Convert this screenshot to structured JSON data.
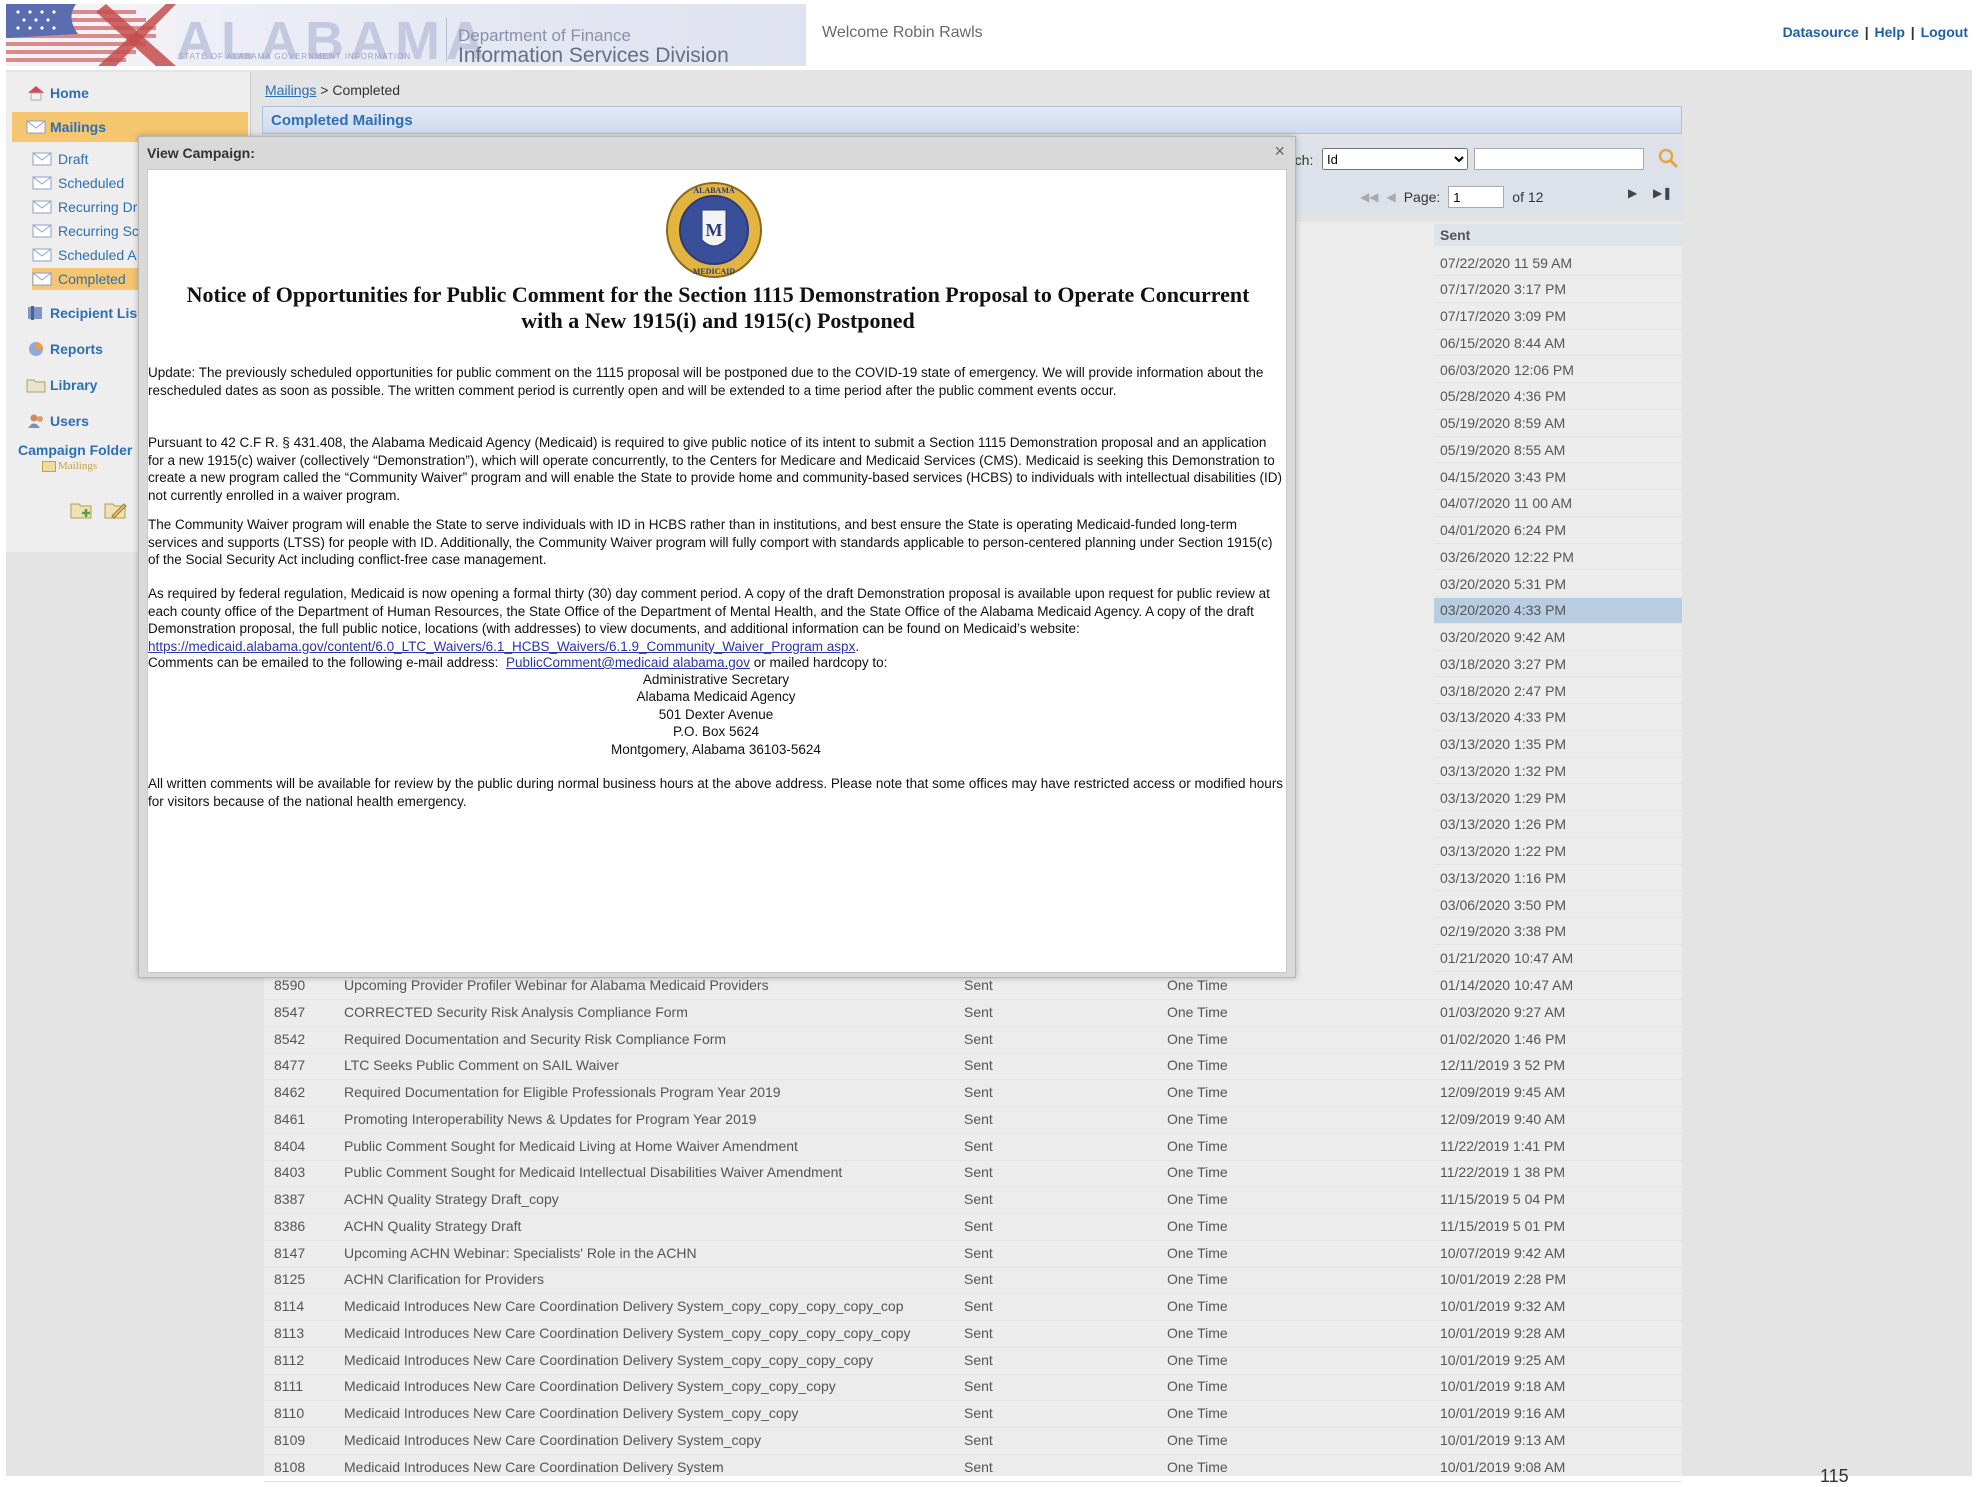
{
  "header": {
    "state_name": "ALABAMA",
    "state_sub": "STATE OF ALABAMA GOVERNMENT INFORMATION",
    "dept_line1": "Department of Finance",
    "dept_line2": "Information Services Division",
    "welcome": "Welcome Robin Rawls",
    "links": [
      "Datasource",
      "Help",
      "Logout"
    ]
  },
  "sidebar": {
    "main_items": [
      {
        "label": "Home",
        "icon": "home-icon"
      },
      {
        "label": "Mailings",
        "icon": "envelope-icon",
        "active": true
      },
      {
        "label": "Recipient Lis",
        "icon": "list-icon"
      },
      {
        "label": "Reports",
        "icon": "pie-chart-icon"
      },
      {
        "label": "Library",
        "icon": "folder-icon"
      },
      {
        "label": "Users",
        "icon": "users-icon"
      }
    ],
    "sub_items": [
      {
        "label": "Draft"
      },
      {
        "label": "Scheduled"
      },
      {
        "label": "Recurring Dr"
      },
      {
        "label": "Recurring Sc"
      },
      {
        "label": "Scheduled A"
      },
      {
        "label": "Completed",
        "active": true
      }
    ],
    "campaign_folder_label": "Campaign Folder",
    "folder_name": "Mailings"
  },
  "breadcrumb": {
    "parent": "Mailings",
    "separator": ">",
    "current": "Completed"
  },
  "panel": {
    "title": "Completed Mailings",
    "search_label": "rch:",
    "search_field_value": "Id",
    "search_value": "",
    "page_label": "Page:",
    "page_value": "1",
    "page_of": "of 12"
  },
  "table": {
    "sent_header": "Sent",
    "hidden_sent": [
      "07/22/2020 11 59 AM",
      "07/17/2020 3:17 PM",
      "07/17/2020 3:09 PM",
      "06/15/2020 8:44 AM",
      "06/03/2020 12:06 PM",
      "05/28/2020 4:36 PM",
      "05/19/2020 8:59 AM",
      "05/19/2020 8:55 AM",
      "04/15/2020 3:43 PM",
      "04/07/2020 11 00 AM",
      "04/01/2020 6:24 PM",
      "03/26/2020 12:22 PM",
      "03/20/2020 5:31 PM",
      "03/20/2020 4:33 PM",
      "03/20/2020 9:42 AM",
      "03/18/2020 3:27 PM",
      "03/18/2020 2:47 PM",
      "03/13/2020 4:33 PM",
      "03/13/2020 1:35 PM",
      "03/13/2020 1:32 PM",
      "03/13/2020 1:29 PM",
      "03/13/2020 1:26 PM",
      "03/13/2020 1:22 PM",
      "03/13/2020 1:16 PM",
      "03/06/2020 3:50 PM",
      "02/19/2020 3:38 PM",
      "01/21/2020 10:47 AM"
    ],
    "rows": [
      {
        "id": "8590",
        "name": "Upcoming Provider Profiler Webinar for Alabama Medicaid Providers",
        "status": "Sent",
        "type": "One Time",
        "sent": "01/14/2020 10:47 AM"
      },
      {
        "id": "8547",
        "name": "CORRECTED Security Risk Analysis Compliance Form",
        "status": "Sent",
        "type": "One Time",
        "sent": "01/03/2020 9:27 AM"
      },
      {
        "id": "8542",
        "name": "Required Documentation and Security Risk Compliance Form",
        "status": "Sent",
        "type": "One Time",
        "sent": "01/02/2020 1:46 PM"
      },
      {
        "id": "8477",
        "name": "LTC Seeks Public Comment on SAIL Waiver",
        "status": "Sent",
        "type": "One Time",
        "sent": "12/11/2019 3 52 PM"
      },
      {
        "id": "8462",
        "name": "Required Documentation for Eligible Professionals Program Year 2019",
        "status": "Sent",
        "type": "One Time",
        "sent": "12/09/2019 9:45 AM"
      },
      {
        "id": "8461",
        "name": "Promoting Interoperability News & Updates for Program Year 2019",
        "status": "Sent",
        "type": "One Time",
        "sent": "12/09/2019 9:40 AM"
      },
      {
        "id": "8404",
        "name": "Public Comment Sought for Medicaid Living at Home Waiver Amendment",
        "status": "Sent",
        "type": "One Time",
        "sent": "11/22/2019 1:41 PM"
      },
      {
        "id": "8403",
        "name": "Public Comment Sought for Medicaid Intellectual Disabilities Waiver Amendment",
        "status": "Sent",
        "type": "One Time",
        "sent": "11/22/2019 1 38 PM"
      },
      {
        "id": "8387",
        "name": "ACHN Quality Strategy Draft_copy",
        "status": "Sent",
        "type": "One Time",
        "sent": "11/15/2019 5 04 PM"
      },
      {
        "id": "8386",
        "name": "ACHN Quality Strategy Draft",
        "status": "Sent",
        "type": "One Time",
        "sent": "11/15/2019 5 01 PM"
      },
      {
        "id": "8147",
        "name": "Upcoming ACHN Webinar: Specialists' Role in the ACHN",
        "status": "Sent",
        "type": "One Time",
        "sent": "10/07/2019 9:42 AM"
      },
      {
        "id": "8125",
        "name": "ACHN Clarification for Providers",
        "status": "Sent",
        "type": "One Time",
        "sent": "10/01/2019 2:28 PM"
      },
      {
        "id": "8114",
        "name": "Medicaid Introduces New Care Coordination Delivery System_copy_copy_copy_copy_cop",
        "status": "Sent",
        "type": "One Time",
        "sent": "10/01/2019 9:32 AM"
      },
      {
        "id": "8113",
        "name": "Medicaid Introduces New Care Coordination Delivery System_copy_copy_copy_copy_copy",
        "status": "Sent",
        "type": "One Time",
        "sent": "10/01/2019 9:28 AM"
      },
      {
        "id": "8112",
        "name": "Medicaid Introduces New Care Coordination Delivery System_copy_copy_copy_copy",
        "status": "Sent",
        "type": "One Time",
        "sent": "10/01/2019 9:25 AM"
      },
      {
        "id": "8111",
        "name": "Medicaid Introduces New Care Coordination Delivery System_copy_copy_copy",
        "status": "Sent",
        "type": "One Time",
        "sent": "10/01/2019 9:18 AM"
      },
      {
        "id": "8110",
        "name": "Medicaid Introduces New Care Coordination Delivery System_copy_copy",
        "status": "Sent",
        "type": "One Time",
        "sent": "10/01/2019 9:16 AM"
      },
      {
        "id": "8109",
        "name": "Medicaid Introduces New Care Coordination Delivery System_copy",
        "status": "Sent",
        "type": "One Time",
        "sent": "10/01/2019 9:13 AM"
      },
      {
        "id": "8108",
        "name": "Medicaid Introduces New Care Coordination Delivery System",
        "status": "Sent",
        "type": "One Time",
        "sent": "10/01/2019 9:08 AM"
      }
    ]
  },
  "modal": {
    "title": "View Campaign:",
    "close": "×",
    "seal_top_text": "ALABAMA",
    "seal_bottom_text": "MEDICAID",
    "seal_letter": "M",
    "notice_title": "Notice of Opportunities for Public Comment for the Section 1115 Demonstration Proposal to Operate Concurrent with a New 1915(i) and 1915(c) Postponed",
    "para_update": "Update: The previously scheduled opportunities for public comment on the 1115 proposal will be postponed due to the COVID-19 state of emergency. We will provide information about the rescheduled dates as soon as possible. The written comment period is currently open and will be extended to a time period after the public comment events occur.",
    "para_pursuant": "Pursuant to 42 C.F R. § 431.408, the Alabama Medicaid Agency (Medicaid) is required to give public notice of its intent to submit a Section 1115 Demonstration proposal and an application for a new 1915(c) waiver (collectively “Demonstration”), which will operate concurrently, to the Centers for Medicare and Medicaid Services (CMS). Medicaid is seeking this Demonstration to create a new program called the “Community Waiver” program and will enable the State to provide home and community-based services (HCBS) to individuals with intellectual disabilities (ID) not currently enrolled in a waiver program.",
    "para_community": "The Community Waiver program will enable the State to serve individuals with ID in HCBS rather than in institutions, and best ensure the State is operating Medicaid-funded long-term services and supports (LTSS) for people with ID. Additionally, the Community Waiver program will fully comport with standards applicable to person-centered planning under Section 1915(c) of the Social Security Act including conflict-free case management.",
    "para_required": "As required by federal regulation, Medicaid is now opening a formal thirty (30) day comment period. A copy of the draft Demonstration proposal is available upon request for public review at each county office of the Department of Human Resources, the State Office of the Department of Mental Health, and the State Office of the Alabama Medicaid Agency. A copy of the draft Demonstration proposal, the full public notice, locations (with addresses) to view documents, and additional information can be found on Medicaid’s website: ",
    "website_link": "https://medicaid.alabama.gov/content/6.0_LTC_Waivers/6.1_HCBS_Waivers/6.1.9_Community_Waiver_Program aspx",
    "period": ".",
    "comments_prefix": "Comments can be emailed to the following e-mail address:",
    "email_link": "PublicComment@medicaid alabama.gov",
    "comments_suffix": "or mailed hardcopy to:",
    "address": [
      "Administrative Secretary",
      "Alabama Medicaid Agency",
      "501 Dexter Avenue",
      "P.O. Box 5624",
      "Montgomery, Alabama 36103-5624"
    ],
    "para_final": "All written comments will be available for review by the public during normal business hours at the above address. Please note that some offices may have restricted access or modified hours for visitors because of the national health emergency."
  },
  "page_number": "115",
  "colors": {
    "link": "#2d6fb5",
    "active_nav": "#f5c56f",
    "selected_row": "#b8cde2"
  }
}
